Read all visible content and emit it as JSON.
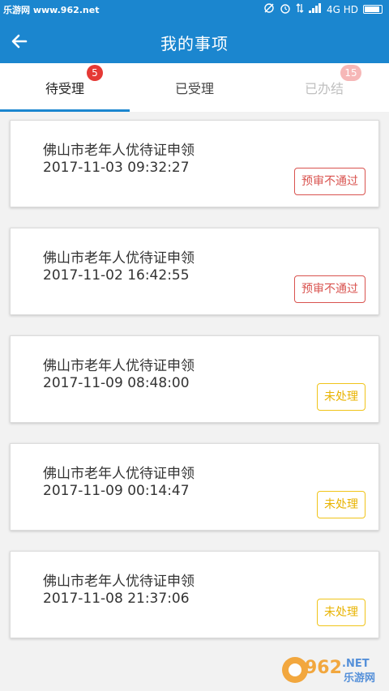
{
  "status_bar": {
    "watermark": "乐游网 www.962.net",
    "network": "4G HD"
  },
  "header": {
    "title": "我的事项"
  },
  "tabs": [
    {
      "label": "待受理",
      "badge": "5"
    },
    {
      "label": "已受理",
      "badge": ""
    },
    {
      "label": "已办结",
      "badge": "15"
    }
  ],
  "items": [
    {
      "title": "佛山市老年人优待证申领",
      "time": "2017-11-03 09:32:27",
      "status": "预审不通过"
    },
    {
      "title": "佛山市老年人优待证申领",
      "time": "2017-11-02 16:42:55",
      "status": "预审不通过"
    },
    {
      "title": "佛山市老年人优待证申领",
      "time": "2017-11-09 08:48:00",
      "status": "未处理"
    },
    {
      "title": "佛山市老年人优待证申领",
      "time": "2017-11-09 00:14:47",
      "status": "未处理"
    },
    {
      "title": "佛山市老年人优待证申领",
      "time": "2017-11-08 21:37:06",
      "status": "未处理"
    }
  ],
  "watermark_logo": {
    "text_top": "962",
    "text_net": ".NET",
    "text_cn": "乐游网"
  },
  "colors": {
    "brand": "#1b86cf",
    "badge_red": "#e53935",
    "status_fail": "#d9534f",
    "status_pending": "#e8b300"
  }
}
